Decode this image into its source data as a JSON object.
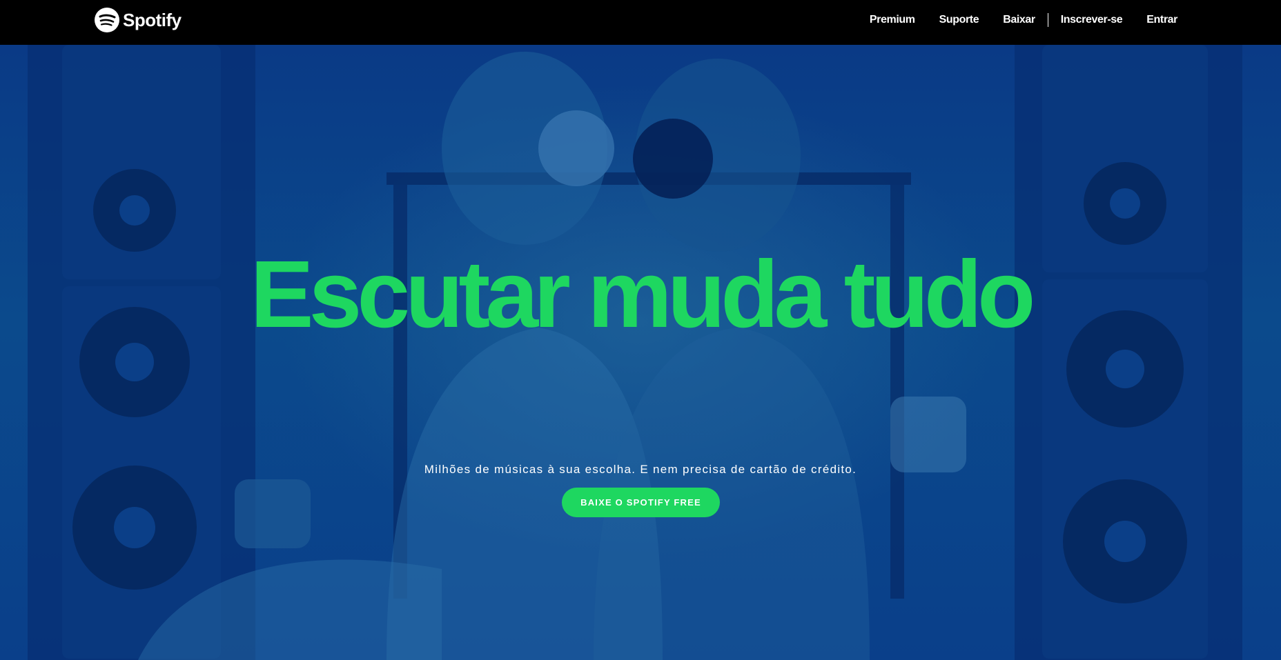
{
  "brand": {
    "name": "Spotify",
    "color_green": "#1ed760",
    "icon": "spotify-logo-icon"
  },
  "nav": {
    "items": [
      "Premium",
      "Suporte",
      "Baixar",
      "Inscrever-se",
      "Entrar"
    ]
  },
  "hero": {
    "title": "Escutar muda tudo",
    "subtitle": "Milhões de músicas à sua escolha. E nem precisa de cartão de crédito.",
    "cta_label": "BAIXE O SPOTIFY FREE",
    "background_image": "couple-with-headphones-speakers-photo"
  }
}
